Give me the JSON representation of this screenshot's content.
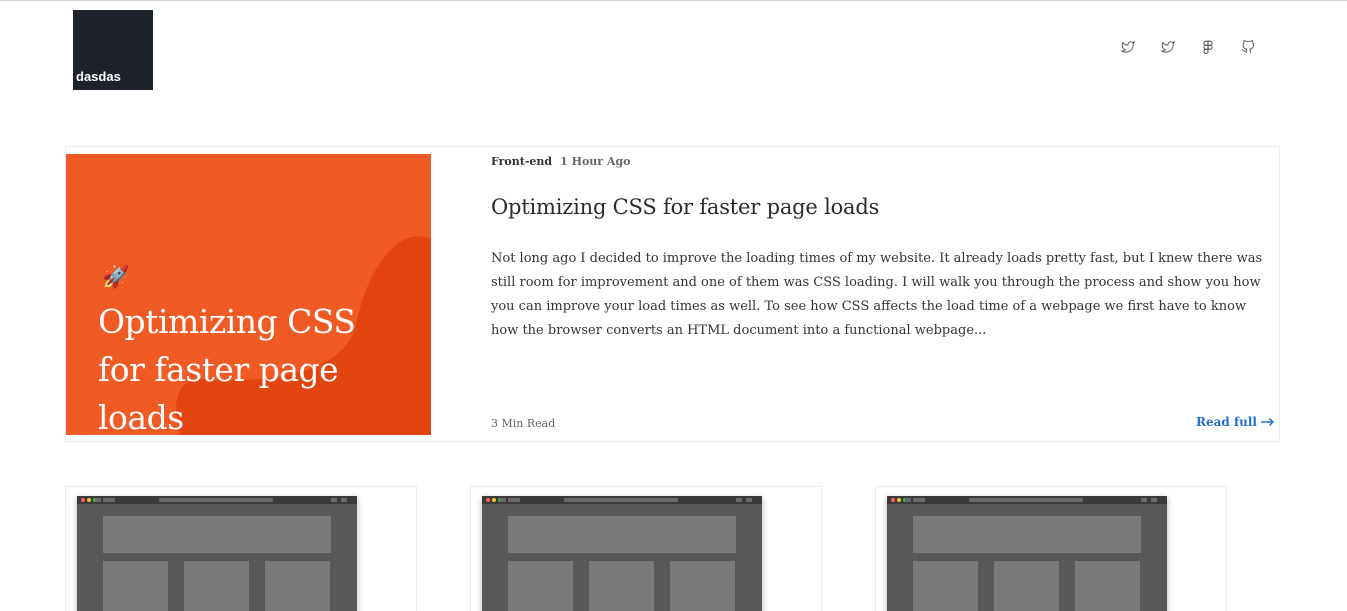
{
  "header": {
    "logo_text": "dasdas",
    "social_links": [
      {
        "icon": "twitter-icon"
      },
      {
        "icon": "twitter-icon"
      },
      {
        "icon": "figma-icon"
      },
      {
        "icon": "github-icon"
      }
    ]
  },
  "featured": {
    "image_title": "Optimizing CSS for faster page loads",
    "image_emoji": "🚀",
    "category": "Front-end",
    "time_ago": "1 Hour Ago",
    "title": "Optimizing CSS for faster page loads",
    "excerpt": "Not long ago I decided to improve the loading times of my website. It already loads pretty fast, but I knew there was still room for improvement and one of them was CSS loading. I will walk you through the process and show you how you can improve your load times as well. To see how CSS affects the load time of a webpage we first have to know how the browser converts an HTML document into a functional webpage...",
    "read_time": "3 Min Read",
    "read_full_label": "Read full",
    "colors": {
      "image_bg": "#f05a24",
      "image_blob": "#e34511",
      "link": "#1f6fd1"
    }
  },
  "cards": [
    {
      "image": "browser-mockup"
    },
    {
      "image": "browser-mockup"
    },
    {
      "image": "browser-mockup"
    }
  ]
}
